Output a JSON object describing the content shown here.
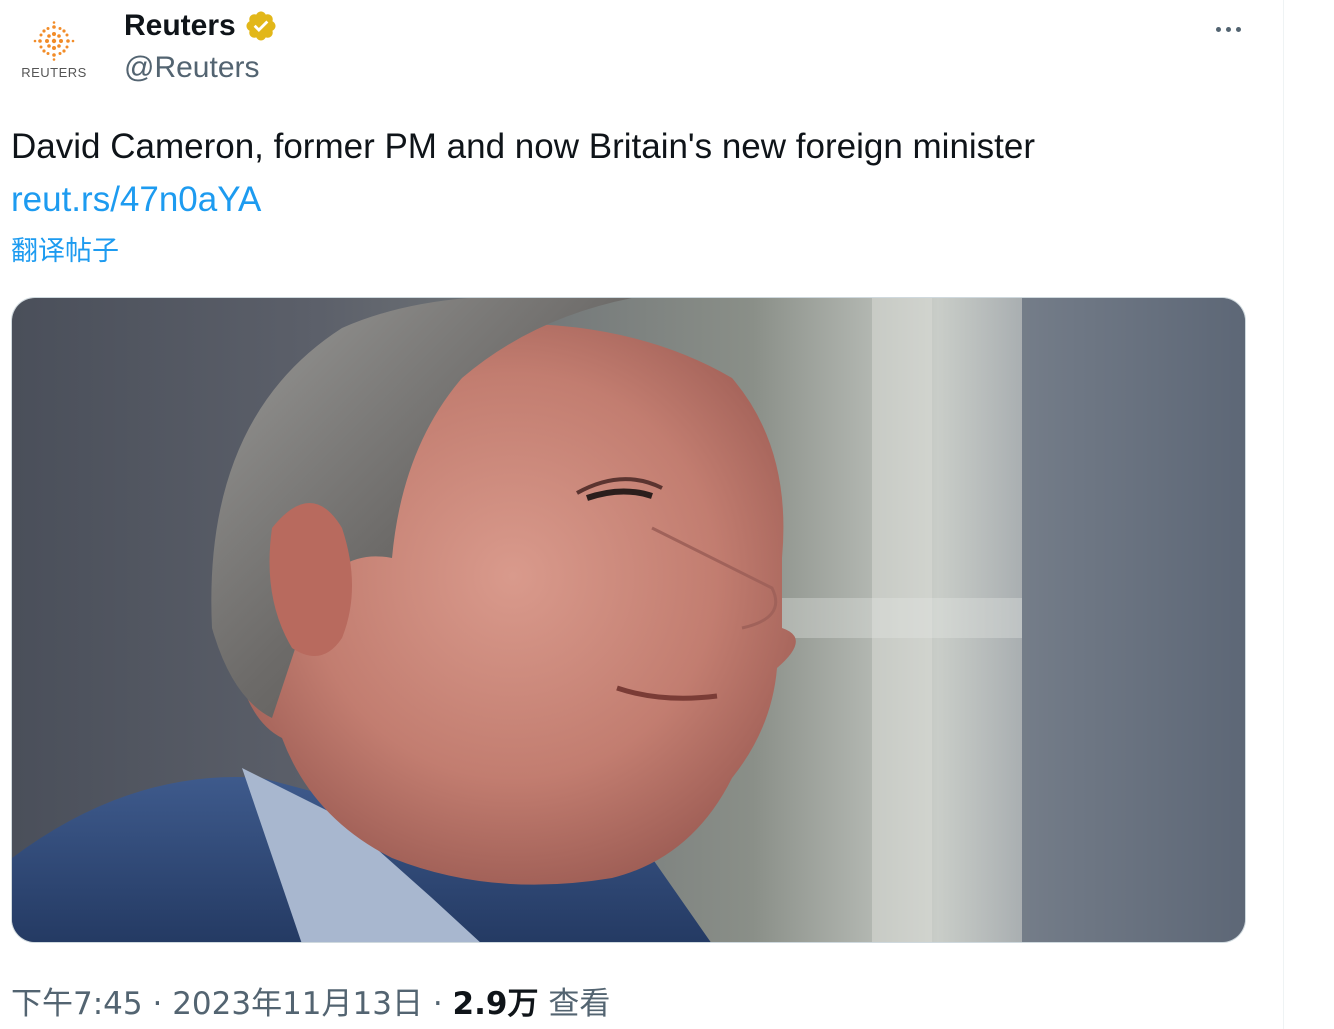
{
  "author": {
    "display_name": "Reuters",
    "handle": "@Reuters",
    "avatar_label": "REUTERS",
    "verified_color": "#e2b719"
  },
  "tweet": {
    "text": "David Cameron, former PM and now Britain's new foreign minister",
    "link": "reut.rs/47n0aYA",
    "translate_label": "翻译帖子"
  },
  "meta": {
    "time": "下午7:45",
    "separator": " · ",
    "date": "2023年11月13日",
    "separator2": " · ",
    "views_count": "2.9万",
    "views_label": " 查看"
  },
  "colors": {
    "link": "#1d9bf0",
    "secondary_text": "#536471",
    "primary_text": "#0f1419",
    "avatar_orange": "#f28c28"
  },
  "icons": {
    "more": "more-horizontal-icon",
    "verified": "verified-badge-icon",
    "logo": "reuters-logo-icon"
  }
}
